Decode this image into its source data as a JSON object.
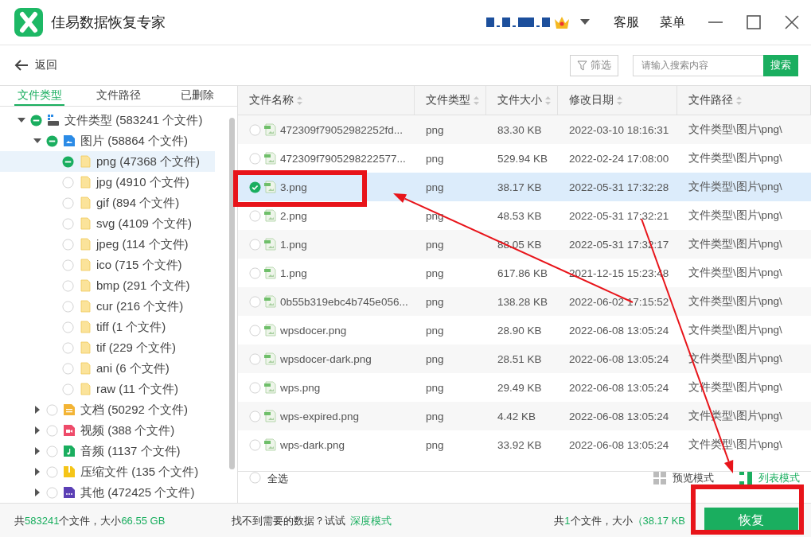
{
  "window": {
    "title": "佳易数据恢复专家",
    "menu": [
      "客服",
      "菜单"
    ]
  },
  "toolbar": {
    "back": "返回",
    "filter": "筛选",
    "search": {
      "placeholder": "请输入搜索内容",
      "button": "搜索"
    }
  },
  "sidebar": {
    "tabs": [
      {
        "label": "文件类型",
        "selected": true
      },
      {
        "label": "文件路径",
        "selected": false
      },
      {
        "label": "已删除",
        "selected": false
      }
    ],
    "tree": [
      {
        "label": "文件类型 (583241 个文件)",
        "kind": "drive",
        "partial": true,
        "expanded": true,
        "selected": false,
        "children": [
          {
            "label": "图片 (58864 个文件)",
            "kind": "image",
            "partial": true,
            "expanded": true,
            "selected": false,
            "children": [
              {
                "label": "png (47368 个文件)",
                "kind": "folder",
                "partial": true,
                "selected": true
              },
              {
                "label": "jpg (4910 个文件)",
                "kind": "folder",
                "partial": false,
                "selected": false
              },
              {
                "label": "gif (894 个文件)",
                "kind": "folder",
                "partial": false,
                "selected": false
              },
              {
                "label": "svg (4109 个文件)",
                "kind": "folder",
                "partial": false,
                "selected": false
              },
              {
                "label": "jpeg (114 个文件)",
                "kind": "folder",
                "partial": false,
                "selected": false
              },
              {
                "label": "ico (715 个文件)",
                "kind": "folder",
                "partial": false,
                "selected": false
              },
              {
                "label": "bmp (291 个文件)",
                "kind": "folder",
                "partial": false,
                "selected": false
              },
              {
                "label": "cur (216 个文件)",
                "kind": "folder",
                "partial": false,
                "selected": false
              },
              {
                "label": "tiff (1 个文件)",
                "kind": "folder",
                "partial": false,
                "selected": false
              },
              {
                "label": "tif (229 个文件)",
                "kind": "folder",
                "partial": false,
                "selected": false
              },
              {
                "label": "ani (6 个文件)",
                "kind": "folder",
                "partial": false,
                "selected": false
              },
              {
                "label": "raw (11 个文件)",
                "kind": "folder",
                "partial": false,
                "selected": false
              }
            ]
          },
          {
            "label": "文档 (50292 个文件)",
            "kind": "document",
            "partial": false,
            "expanded": false,
            "selected": false
          },
          {
            "label": "视频 (388 个文件)",
            "kind": "video",
            "partial": false,
            "expanded": false,
            "selected": false
          },
          {
            "label": "音频 (1137 个文件)",
            "kind": "audio",
            "partial": false,
            "expanded": false,
            "selected": false
          },
          {
            "label": "压缩文件 (135 个文件)",
            "kind": "archive",
            "partial": false,
            "expanded": false,
            "selected": false
          },
          {
            "label": "其他 (472425 个文件)",
            "kind": "other",
            "partial": false,
            "expanded": false,
            "selected": false
          }
        ]
      }
    ]
  },
  "table": {
    "columns": [
      "文件名称",
      "文件类型",
      "文件大小",
      "修改日期",
      "文件路径"
    ],
    "rows": [
      {
        "name": "472309f79052982252fd...",
        "type": "png",
        "size": "83.30 KB",
        "date": "2022-03-10 18:16:31",
        "path": "文件类型\\图片\\png\\",
        "checked": false,
        "selected": false
      },
      {
        "name": "472309f7905298222577...",
        "type": "png",
        "size": "529.94 KB",
        "date": "2022-02-24 17:08:00",
        "path": "文件类型\\图片\\png\\",
        "checked": false,
        "selected": false
      },
      {
        "name": "3.png",
        "type": "png",
        "size": "38.17 KB",
        "date": "2022-05-31 17:32:28",
        "path": "文件类型\\图片\\png\\",
        "checked": true,
        "selected": true
      },
      {
        "name": "2.png",
        "type": "png",
        "size": "48.53 KB",
        "date": "2022-05-31 17:32:21",
        "path": "文件类型\\图片\\png\\",
        "checked": false,
        "selected": false
      },
      {
        "name": "1.png",
        "type": "png",
        "size": "88.05 KB",
        "date": "2022-05-31 17:32:17",
        "path": "文件类型\\图片\\png\\",
        "checked": false,
        "selected": false
      },
      {
        "name": "1.png",
        "type": "png",
        "size": "617.86 KB",
        "date": "2021-12-15 15:23:48",
        "path": "文件类型\\图片\\png\\",
        "checked": false,
        "selected": false
      },
      {
        "name": "0b55b319ebc4b745e056...",
        "type": "png",
        "size": "138.28 KB",
        "date": "2022-06-02 17:15:52",
        "path": "文件类型\\图片\\png\\",
        "checked": false,
        "selected": false
      },
      {
        "name": "wpsdocer.png",
        "type": "png",
        "size": "28.90 KB",
        "date": "2022-06-08 13:05:24",
        "path": "文件类型\\图片\\png\\",
        "checked": false,
        "selected": false
      },
      {
        "name": "wpsdocer-dark.png",
        "type": "png",
        "size": "28.51 KB",
        "date": "2022-06-08 13:05:24",
        "path": "文件类型\\图片\\png\\",
        "checked": false,
        "selected": false
      },
      {
        "name": "wps.png",
        "type": "png",
        "size": "29.49 KB",
        "date": "2022-06-08 13:05:24",
        "path": "文件类型\\图片\\png\\",
        "checked": false,
        "selected": false
      },
      {
        "name": "wps-expired.png",
        "type": "png",
        "size": "4.42 KB",
        "date": "2022-06-08 13:05:24",
        "path": "文件类型\\图片\\png\\",
        "checked": false,
        "selected": false
      },
      {
        "name": "wps-dark.png",
        "type": "png",
        "size": "33.92 KB",
        "date": "2022-06-08 13:05:24",
        "path": "文件类型\\图片\\png\\",
        "checked": false,
        "selected": false
      }
    ]
  },
  "list_bar": {
    "select_all": {
      "label": "全选",
      "checked": false
    },
    "views": [
      {
        "label": "预览模式",
        "kind": "grid",
        "selected": false
      },
      {
        "label": "列表模式",
        "kind": "list",
        "selected": true
      }
    ]
  },
  "status_bar": {
    "summary": [
      {
        "text": "共",
        "accent": false
      },
      {
        "text": "583241",
        "accent": true
      },
      {
        "text": "个文件，大小",
        "accent": false
      },
      {
        "text": "66.55 GB",
        "accent": true
      }
    ],
    "hint": "找不到需要的数据？试试",
    "hint_link": "深度模式",
    "selection": [
      {
        "text": "共",
        "accent": false
      },
      {
        "text": "1",
        "accent": true
      },
      {
        "text": "个文件，大小",
        "accent": false
      },
      {
        "text": "（38.17 KB",
        "accent": true
      }
    ],
    "recover": "恢复"
  },
  "annotations": [
    {
      "kind": "frame"
    },
    {
      "kind": "frame"
    },
    {
      "kind": "arrow"
    },
    {
      "kind": "arrow"
    }
  ]
}
